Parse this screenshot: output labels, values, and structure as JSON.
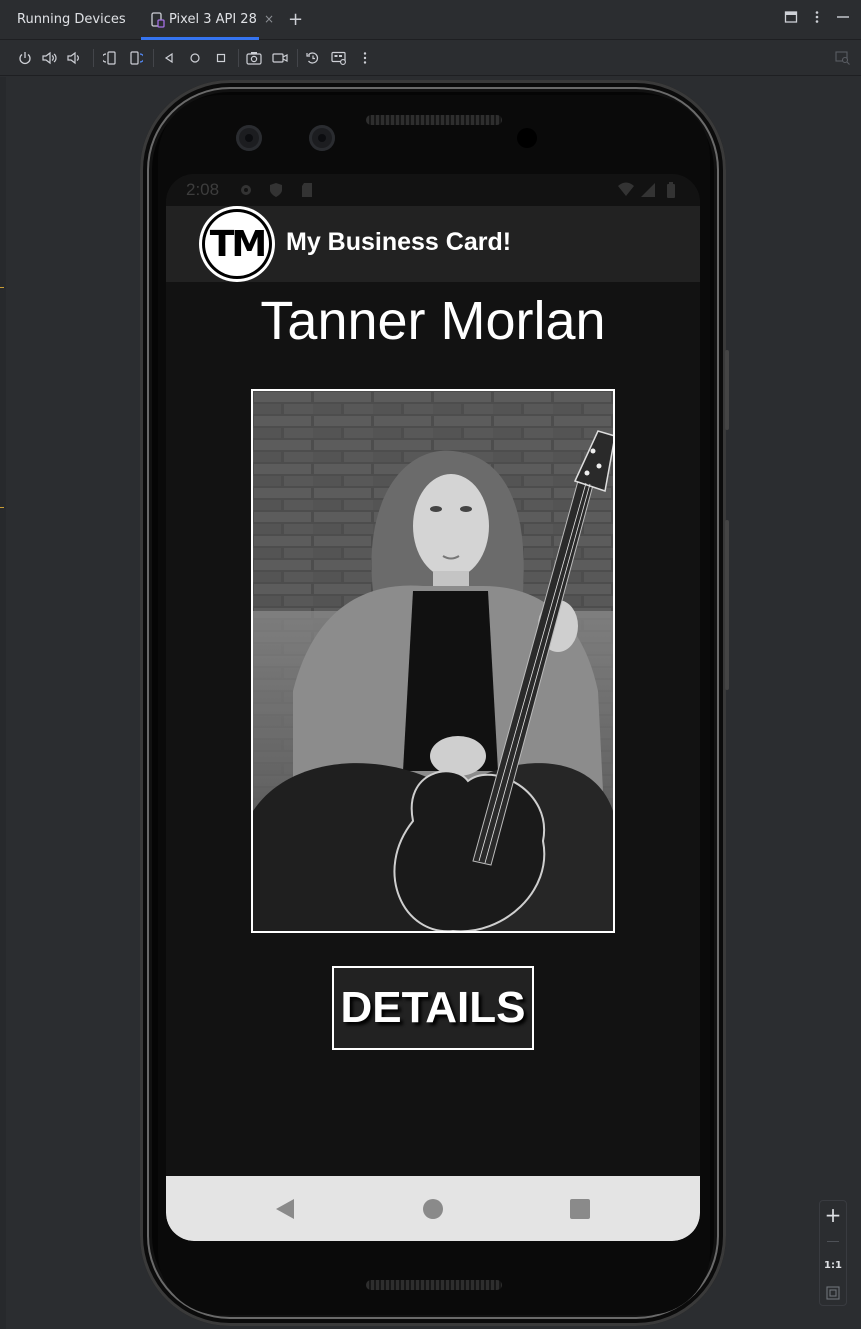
{
  "tool_window": {
    "title": "Running Devices",
    "tab_label": "Pixel 3 API 28",
    "tab_close": "×",
    "add_tab": "+"
  },
  "device_toolbar": {
    "icons": [
      "power-icon",
      "volume-up-icon",
      "volume-down-icon",
      "rotate-left-icon",
      "rotate-right-icon",
      "back-icon",
      "home-icon",
      "overview-icon",
      "screenshot-icon",
      "screen-record-icon",
      "snapshot-icon",
      "extended-controls-icon",
      "more-options-icon"
    ]
  },
  "status_bar": {
    "time": "2:08"
  },
  "app": {
    "logo_text": "TM",
    "title": "My Business Card!",
    "name": "Tanner Morlan",
    "photo_subject": "Black-and-white portrait of a long-haired young man in a denim jacket holding an electric guitar in front of a brick wall",
    "details_button": "DETAILS"
  },
  "zoom": {
    "plus": "+",
    "minus": "—",
    "actual_size": "1:1"
  },
  "colors": {
    "ide_background": "#2b2d30",
    "screen_background": "#121212",
    "app_bar": "#222222",
    "nav_bar": "#e4e4e4",
    "accent": "#3574f0"
  }
}
